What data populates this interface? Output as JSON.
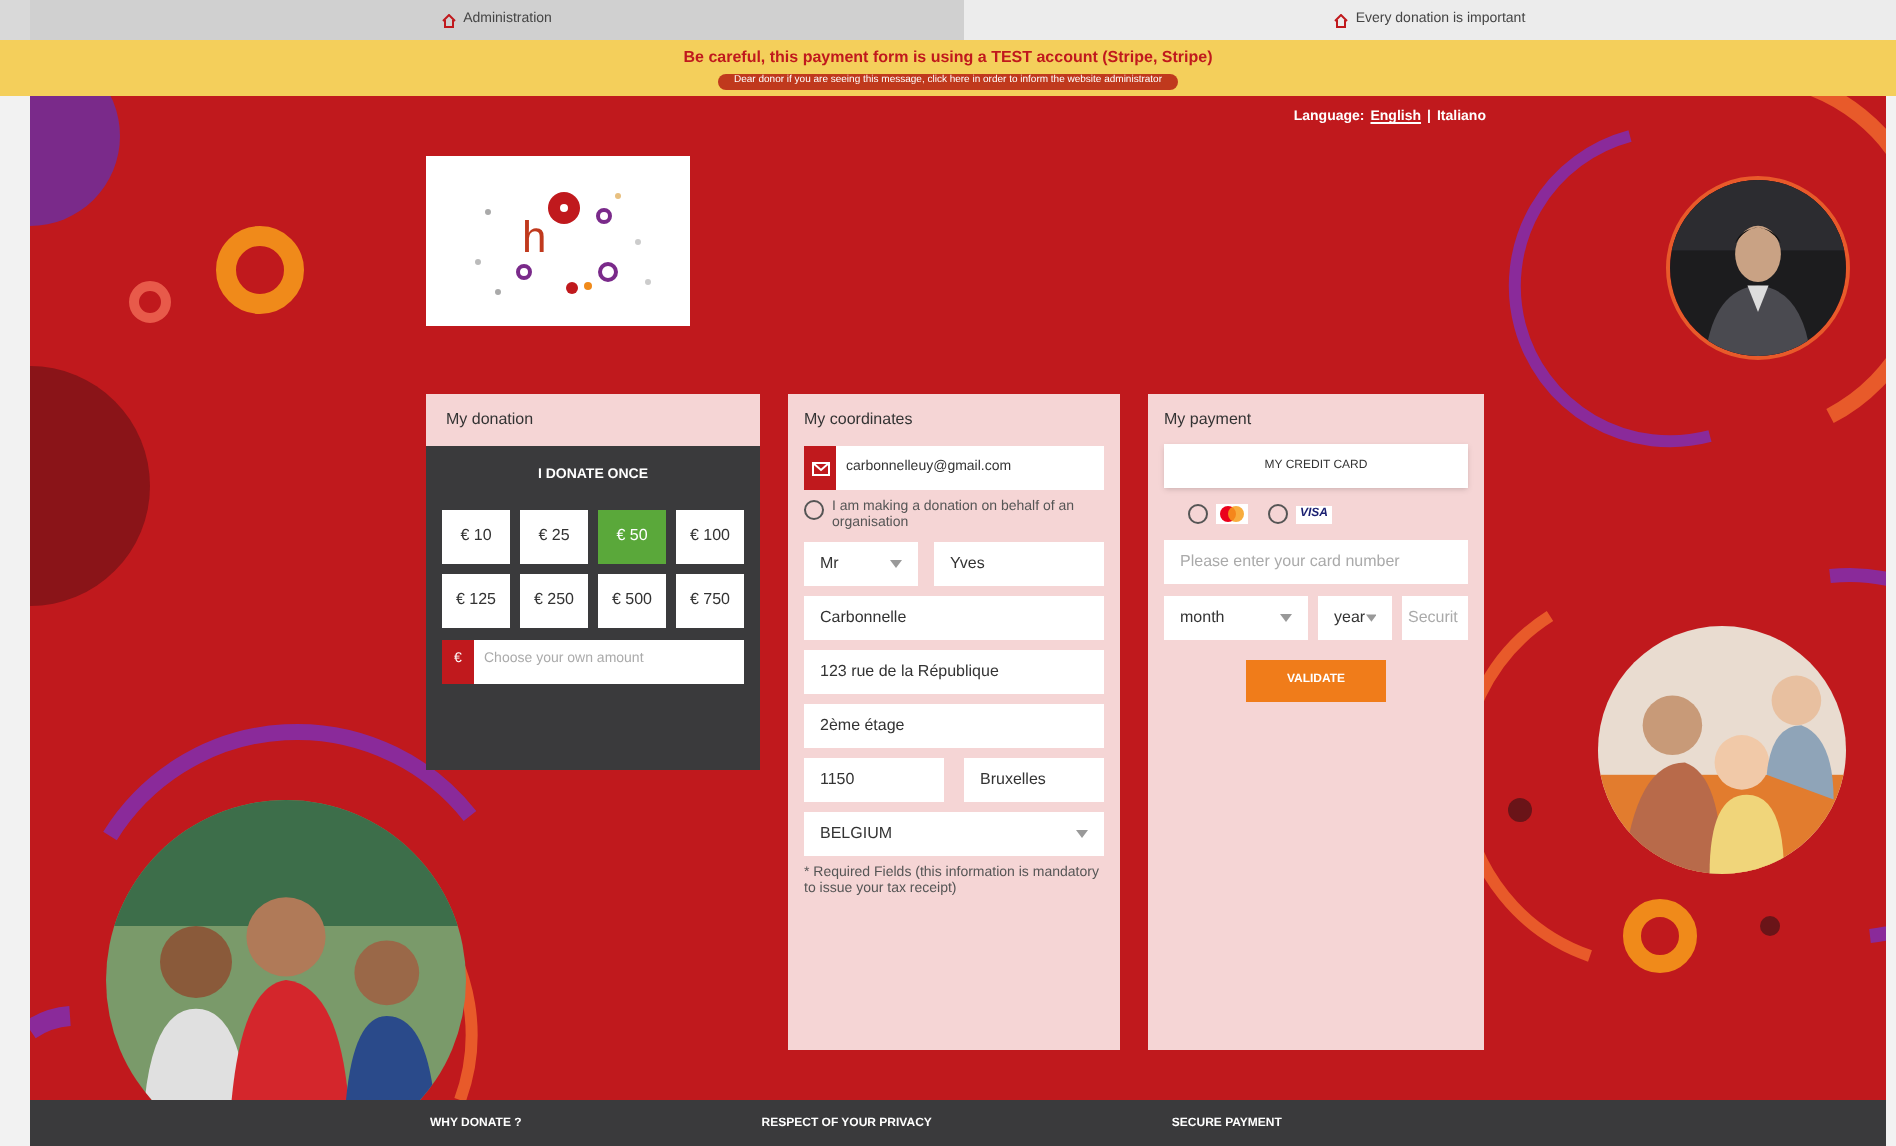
{
  "tabs": [
    {
      "label": "Administration",
      "selected": false
    },
    {
      "label": "Every donation is important",
      "selected": true
    }
  ],
  "banner": {
    "title": "Be careful, this payment form is using a TEST account (Stripe, Stripe)",
    "link": "Dear donor if you are seeing this message, click here in order to inform the website administrator"
  },
  "language": {
    "label": "Language:",
    "separator": "|",
    "options": [
      {
        "label": "English",
        "selected": true
      },
      {
        "label": "Italiano",
        "selected": false
      }
    ]
  },
  "logo": {
    "letter": "h"
  },
  "donation": {
    "title": "My donation",
    "frequency": "I DONATE ONCE",
    "amounts": [
      {
        "label": "€ 10",
        "selected": false
      },
      {
        "label": "€ 25",
        "selected": false
      },
      {
        "label": "€ 50",
        "selected": true
      },
      {
        "label": "€ 100",
        "selected": false
      },
      {
        "label": "€ 125",
        "selected": false
      },
      {
        "label": "€ 250",
        "selected": false
      },
      {
        "label": "€ 500",
        "selected": false
      },
      {
        "label": "€ 750",
        "selected": false
      }
    ],
    "currency": "€",
    "custom_placeholder": "Choose your own amount"
  },
  "coordinates": {
    "title": "My coordinates",
    "email": "carbonnelleuy@gmail.com",
    "organisation": {
      "label": "I am making a donation on behalf of an organisation",
      "checked": false
    },
    "civility": "Mr",
    "first_name": "Yves",
    "last_name": "Carbonnelle",
    "address": "123 rue de la République",
    "address2": "2ème étage",
    "zip": "1150",
    "city": "Bruxelles",
    "country": "BELGIUM",
    "note": "* Required Fields (this information is mandatory to issue your tax receipt)"
  },
  "payment": {
    "title": "My payment",
    "method": "MY CREDIT CARD",
    "cards": [
      {
        "kind": "mastercard",
        "selected": false
      },
      {
        "kind": "visa",
        "label": "VISA",
        "selected": false
      }
    ],
    "card_placeholder": "Please enter your card number",
    "month": "month",
    "year": "year",
    "security_placeholder": "Securit",
    "button": "VALIDATE"
  },
  "footer": [
    "WHY DONATE ?",
    "RESPECT OF YOUR PRIVACY",
    "SECURE PAYMENT"
  ]
}
